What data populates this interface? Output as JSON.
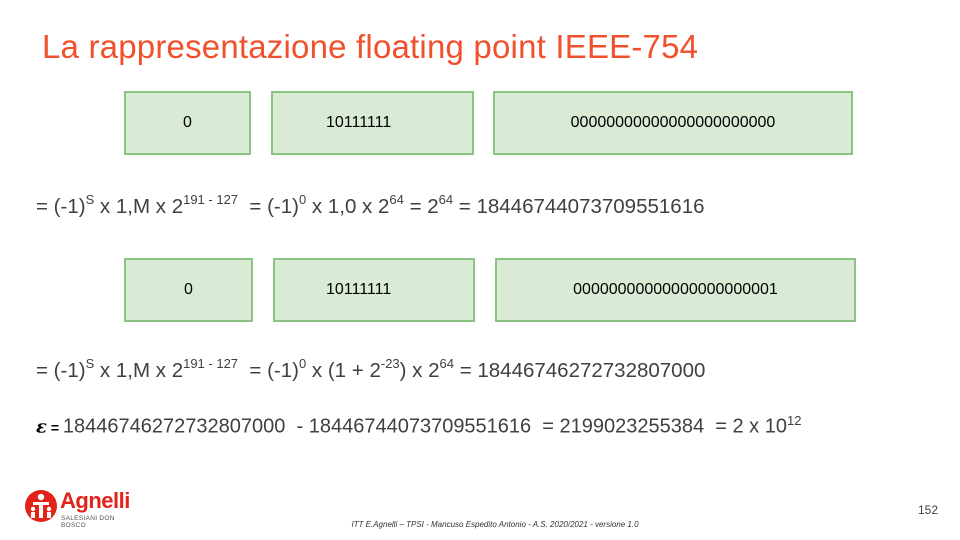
{
  "title": "La rappresentazione floating point IEEE-754",
  "row1": {
    "sign": "0",
    "exponent": "10111111",
    "mantissa": "00000000000000000000000"
  },
  "row2": {
    "sign": "0",
    "exponent": "10111111",
    "mantissa": "00000000000000000000001"
  },
  "eq1": {
    "p1": "= (-1)",
    "s": "S",
    "p2": " x 1,M x 2",
    "exp": "191 - 127",
    "p3": "  = (-1)",
    "zero": "0",
    "p4": " x 1,0 x 2",
    "e64a": "64",
    "p5": " = 2",
    "e64b": "64",
    "p6": " = 18446744073709551616"
  },
  "eq2": {
    "p1": "= (-1)",
    "s": "S",
    "p2": " x 1,M x 2",
    "exp": "191 - 127",
    "p3": "  = (-1)",
    "zero": "0",
    "p4": " x (1 + 2",
    "em23": "-23",
    "p5": ") x 2",
    "e64": "64",
    "p6": " = 18446746272732807000"
  },
  "epsilon": {
    "symbol": "ε",
    "eq": " = ",
    "text": "18446746272732807000  - 18446744073709551616  = 2199023255384  = 2 x 10",
    "exp": "12"
  },
  "logo": {
    "name": "Agnelli",
    "sub": "SALESIANI DON BOSCO"
  },
  "page_number": "152",
  "footer": "ITT E.Agnelli – TPSI  - Mancuso Espedito Antonio - A.S. 2020/2021  - versione 1.0",
  "colors": {
    "title": "#f0502c",
    "box_fill": "#d9ebd5",
    "box_border": "#8bc382",
    "logo_red": "#e2231a"
  }
}
